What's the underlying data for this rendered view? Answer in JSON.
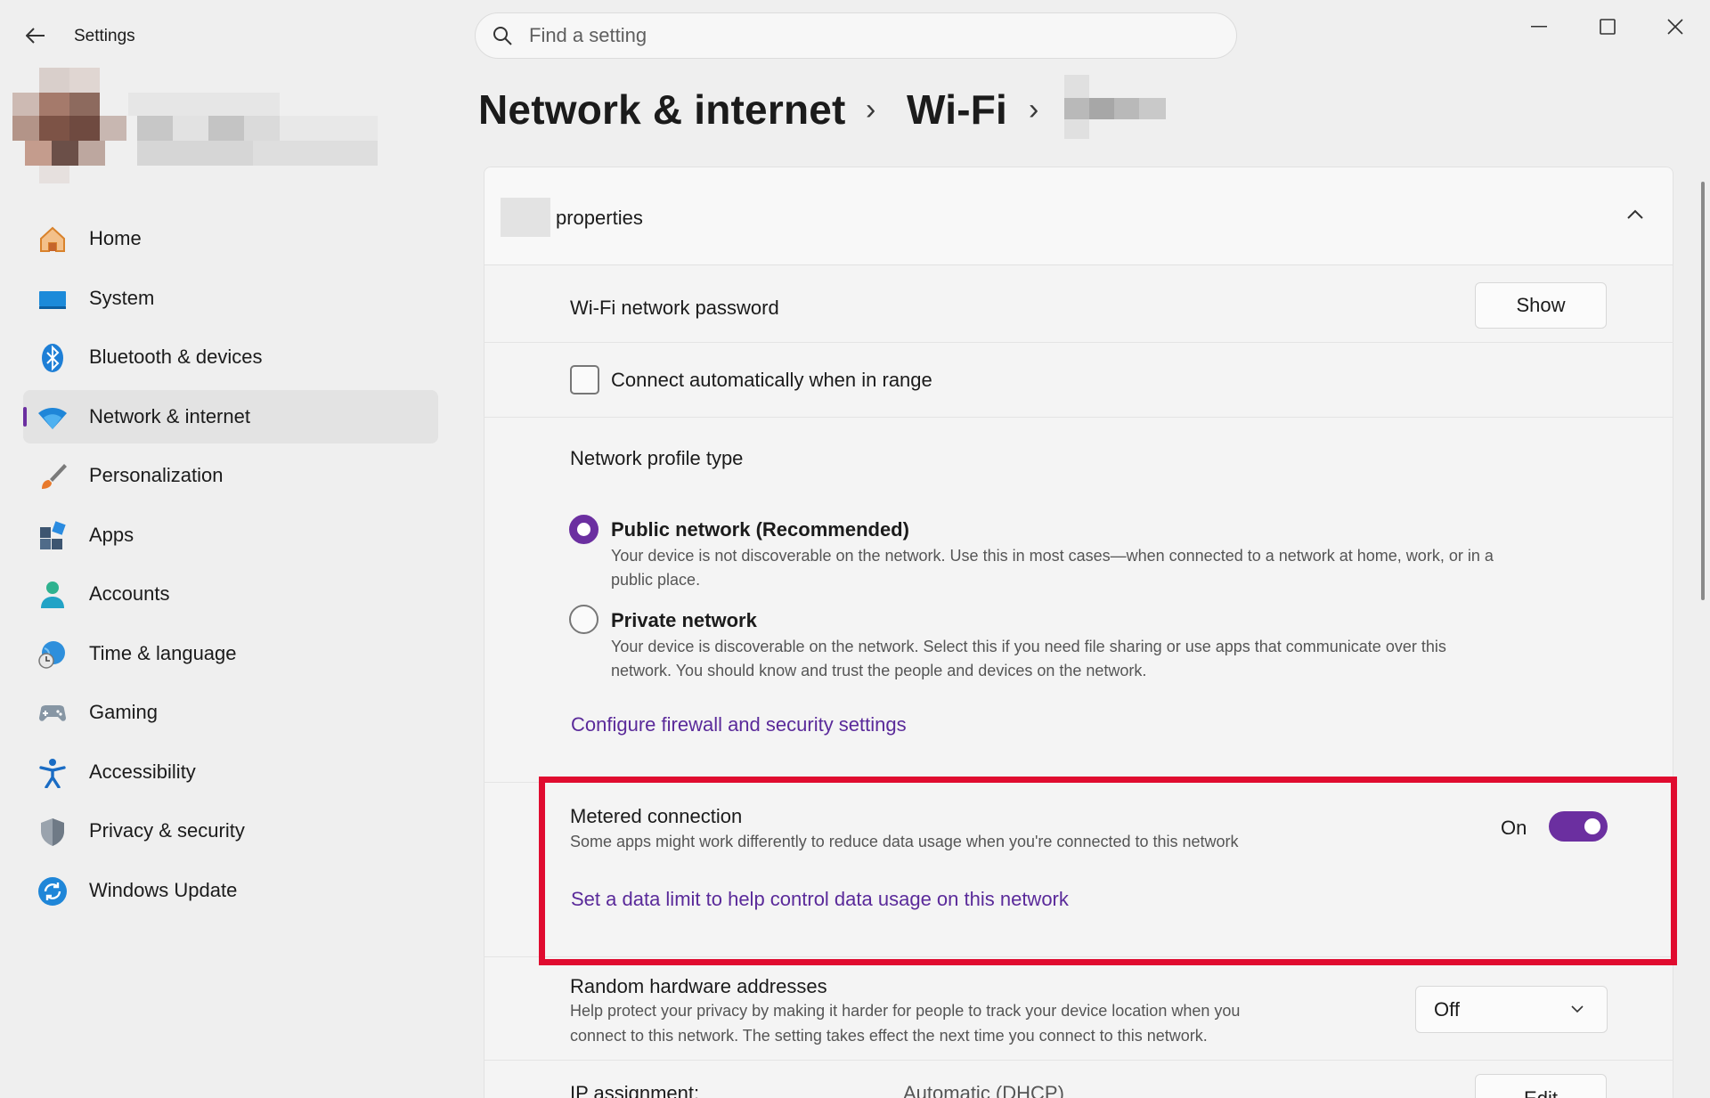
{
  "app": {
    "title": "Settings"
  },
  "search": {
    "placeholder": "Find a setting"
  },
  "nav": [
    {
      "label": "Home",
      "icon": "home-icon"
    },
    {
      "label": "System",
      "icon": "system-icon"
    },
    {
      "label": "Bluetooth & devices",
      "icon": "bluetooth-icon"
    },
    {
      "label": "Network & internet",
      "icon": "wifi-icon",
      "selected": true
    },
    {
      "label": "Personalization",
      "icon": "brush-icon"
    },
    {
      "label": "Apps",
      "icon": "apps-icon"
    },
    {
      "label": "Accounts",
      "icon": "accounts-icon"
    },
    {
      "label": "Time & language",
      "icon": "globe-clock-icon"
    },
    {
      "label": "Gaming",
      "icon": "gamepad-icon"
    },
    {
      "label": "Accessibility",
      "icon": "accessibility-icon"
    },
    {
      "label": "Privacy & security",
      "icon": "shield-icon"
    },
    {
      "label": "Windows Update",
      "icon": "update-icon"
    }
  ],
  "breadcrumb": {
    "level1": "Network & internet",
    "level2": "Wi-Fi",
    "separator": "›"
  },
  "properties": {
    "title": "properties",
    "password_label": "Wi-Fi network password",
    "show_label": "Show",
    "auto_connect_label": "Connect automatically when in range",
    "auto_connect_checked": false,
    "profile_type_label": "Network profile type",
    "public_title": "Public network (Recommended)",
    "public_desc_1": "Your device is not discoverable on the network. Use this in most cases—when connected to a network at home, work, or in a",
    "public_desc_2": "public place.",
    "private_title": "Private network",
    "private_desc_1": "Your device is discoverable on the network. Select this if you need file sharing or use apps that communicate over this",
    "private_desc_2": "network. You should know and trust the people and devices on the network.",
    "firewall_link": "Configure firewall and security settings",
    "metered_title": "Metered connection",
    "metered_desc": "Some apps might work differently to reduce data usage when you're connected to this network",
    "metered_state": "On",
    "data_limit_link": "Set a data limit to help control data usage on this network",
    "random_hw_title": "Random hardware addresses",
    "random_hw_desc_1": "Help protect your privacy by making it harder for people to track your device location when you",
    "random_hw_desc_2": "connect to this network. The setting takes effect the next time you connect to this network.",
    "random_hw_value": "Off",
    "ip_label": "IP assignment:",
    "ip_value": "Automatic (DHCP)",
    "edit_label": "Edit"
  },
  "colors": {
    "accent": "#6b2fa0",
    "highlight": "#e00b2f",
    "link": "#5a2a9a"
  }
}
